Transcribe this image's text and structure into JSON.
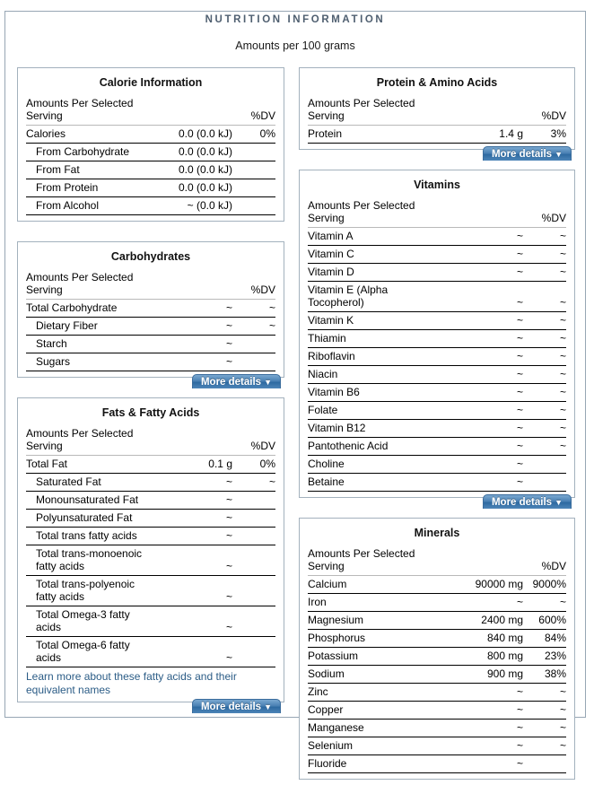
{
  "page": {
    "legend": "NUTRITION INFORMATION",
    "subtitle": "Amounts per 100 grams",
    "more_details_label": "More details",
    "caret": "▼",
    "serving_header": "Amounts Per Selected Serving",
    "dv_header": "%DV",
    "accent_color": "#4a81b4",
    "frame_color": "#97a6b4",
    "link_color": "#2b5c86"
  },
  "panels": {
    "calorie": {
      "title": "Calorie Information",
      "rows": [
        {
          "label": "Calories",
          "indent": false,
          "amount": "0.0 (0.0 kJ)",
          "dv": "0%"
        },
        {
          "label": "From Carbohydrate",
          "indent": true,
          "amount": "0.0 (0.0 kJ)",
          "dv": ""
        },
        {
          "label": "From Fat",
          "indent": true,
          "amount": "0.0 (0.0 kJ)",
          "dv": ""
        },
        {
          "label": "From Protein",
          "indent": true,
          "amount": "0.0 (0.0 kJ)",
          "dv": ""
        },
        {
          "label": "From Alcohol",
          "indent": true,
          "amount": "~ (0.0 kJ)",
          "dv": ""
        }
      ],
      "has_more_details": false
    },
    "carbohydrates": {
      "title": "Carbohydrates",
      "rows": [
        {
          "label": "Total Carbohydrate",
          "indent": false,
          "amount": "~",
          "dv": "~"
        },
        {
          "label": "Dietary Fiber",
          "indent": true,
          "amount": "~",
          "dv": "~"
        },
        {
          "label": "Starch",
          "indent": true,
          "amount": "~",
          "dv": ""
        },
        {
          "label": "Sugars",
          "indent": true,
          "amount": "~",
          "dv": ""
        }
      ],
      "has_more_details": true
    },
    "fats": {
      "title": "Fats & Fatty Acids",
      "rows": [
        {
          "label": "Total Fat",
          "indent": false,
          "amount": "0.1 g",
          "dv": "0%",
          "wrap": false
        },
        {
          "label": "Saturated Fat",
          "indent": true,
          "amount": "~",
          "dv": "~",
          "wrap": false
        },
        {
          "label": "Monounsaturated Fat",
          "indent": true,
          "amount": "~",
          "dv": "",
          "wrap": false
        },
        {
          "label": "Polyunsaturated Fat",
          "indent": true,
          "amount": "~",
          "dv": "",
          "wrap": false
        },
        {
          "label": "Total trans fatty acids",
          "indent": true,
          "amount": "~",
          "dv": "",
          "wrap": false
        },
        {
          "label": "Total trans-monoenoic fatty acids",
          "indent": true,
          "amount": "~",
          "dv": "",
          "wrap": true
        },
        {
          "label": "Total trans-polyenoic fatty acids",
          "indent": true,
          "amount": "~",
          "dv": "",
          "wrap": true
        },
        {
          "label": "Total Omega-3 fatty acids",
          "indent": true,
          "amount": "~",
          "dv": "",
          "wrap": false
        },
        {
          "label": "Total Omega-6 fatty acids",
          "indent": true,
          "amount": "~",
          "dv": "",
          "wrap": false
        }
      ],
      "link_text": "Learn more about these fatty acids and their equivalent names",
      "has_more_details": true
    },
    "protein": {
      "title": "Protein & Amino Acids",
      "rows": [
        {
          "label": "Protein",
          "indent": false,
          "amount": "1.4 g",
          "dv": "3%"
        }
      ],
      "has_more_details": true
    },
    "vitamins": {
      "title": "Vitamins",
      "rows": [
        {
          "label": "Vitamin A",
          "indent": false,
          "amount": "~",
          "dv": "~"
        },
        {
          "label": "Vitamin C",
          "indent": false,
          "amount": "~",
          "dv": "~"
        },
        {
          "label": "Vitamin D",
          "indent": false,
          "amount": "~",
          "dv": "~"
        },
        {
          "label": "Vitamin E (Alpha Tocopherol)",
          "indent": false,
          "amount": "~",
          "dv": "~"
        },
        {
          "label": "Vitamin K",
          "indent": false,
          "amount": "~",
          "dv": "~"
        },
        {
          "label": "Thiamin",
          "indent": false,
          "amount": "~",
          "dv": "~"
        },
        {
          "label": "Riboflavin",
          "indent": false,
          "amount": "~",
          "dv": "~"
        },
        {
          "label": "Niacin",
          "indent": false,
          "amount": "~",
          "dv": "~"
        },
        {
          "label": "Vitamin B6",
          "indent": false,
          "amount": "~",
          "dv": "~"
        },
        {
          "label": "Folate",
          "indent": false,
          "amount": "~",
          "dv": "~"
        },
        {
          "label": "Vitamin B12",
          "indent": false,
          "amount": "~",
          "dv": "~"
        },
        {
          "label": "Pantothenic Acid",
          "indent": false,
          "amount": "~",
          "dv": "~"
        },
        {
          "label": "Choline",
          "indent": false,
          "amount": "~",
          "dv": ""
        },
        {
          "label": "Betaine",
          "indent": false,
          "amount": "~",
          "dv": ""
        }
      ],
      "has_more_details": true
    },
    "minerals": {
      "title": "Minerals",
      "rows": [
        {
          "label": "Calcium",
          "indent": false,
          "amount": "90000 mg",
          "dv": "9000%"
        },
        {
          "label": "Iron",
          "indent": false,
          "amount": "~",
          "dv": "~"
        },
        {
          "label": "Magnesium",
          "indent": false,
          "amount": "2400 mg",
          "dv": "600%"
        },
        {
          "label": "Phosphorus",
          "indent": false,
          "amount": "840 mg",
          "dv": "84%"
        },
        {
          "label": "Potassium",
          "indent": false,
          "amount": "800 mg",
          "dv": "23%"
        },
        {
          "label": "Sodium",
          "indent": false,
          "amount": "900 mg",
          "dv": "38%"
        },
        {
          "label": "Zinc",
          "indent": false,
          "amount": "~",
          "dv": "~"
        },
        {
          "label": "Copper",
          "indent": false,
          "amount": "~",
          "dv": "~"
        },
        {
          "label": "Manganese",
          "indent": false,
          "amount": "~",
          "dv": "~"
        },
        {
          "label": "Selenium",
          "indent": false,
          "amount": "~",
          "dv": "~"
        },
        {
          "label": "Fluoride",
          "indent": false,
          "amount": "~",
          "dv": ""
        }
      ],
      "has_more_details": false
    }
  }
}
